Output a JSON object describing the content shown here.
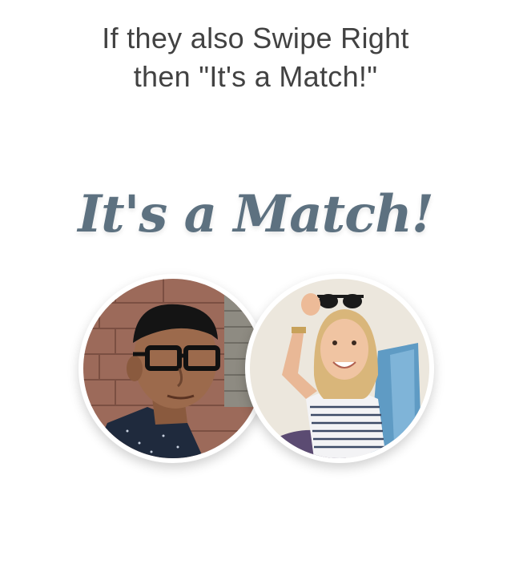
{
  "headline": {
    "line1": "If they also Swipe Right",
    "line2": "then \"It's a Match!\""
  },
  "match_title": "It's a Match!",
  "colors": {
    "headline_text": "#424242",
    "match_title": "#5d7180",
    "background": "#ffffff"
  },
  "avatars": [
    {
      "icon": "man-with-glasses-photo"
    },
    {
      "icon": "woman-with-sunglasses-photo"
    }
  ]
}
